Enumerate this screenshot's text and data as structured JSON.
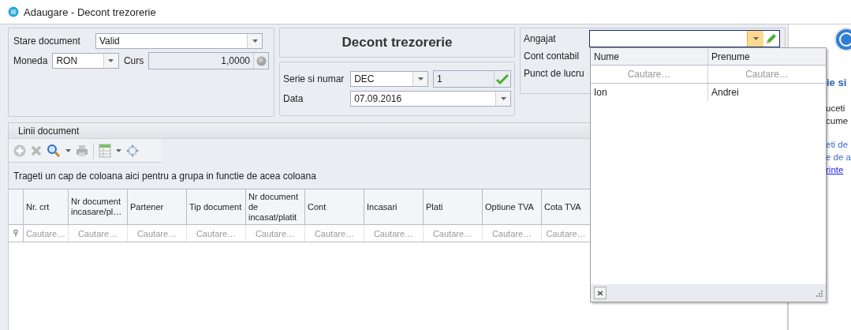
{
  "window": {
    "title": "Adaugare - Decont trezorerie"
  },
  "document": {
    "status_label": "Stare document",
    "status": "Valid",
    "currency_label": "Moneda",
    "currency": "RON",
    "rate_label": "Curs",
    "rate": "1,0000"
  },
  "header_title": "Decont trezorerie",
  "series": {
    "label": "Serie si numar",
    "series": "DEC",
    "number": "1",
    "date_label": "Data",
    "date": "07.09.2016"
  },
  "employee": {
    "label": "Angajat",
    "account_label": "Cont contabil",
    "workpoint_label": "Punct de lucru"
  },
  "lines": {
    "title": "Linii document",
    "toolbar": [
      {
        "kind": "add"
      },
      {
        "kind": "delete"
      },
      {
        "kind": "search"
      },
      {
        "kind": "print"
      },
      {
        "kind": "separator"
      },
      {
        "kind": "layout"
      },
      {
        "kind": "move"
      }
    ],
    "group_hint": "Trageti un cap de coloana aici pentru a grupa in functie de acea coloana",
    "columns": [
      {
        "header": "Nr. crt",
        "filter": "Cautare…"
      },
      {
        "header": "Nr document incasare/pl…",
        "filter": "Cautare…"
      },
      {
        "header": "Partener",
        "filter": "Cautare…"
      },
      {
        "header": "Tip document",
        "filter": "Cautare…"
      },
      {
        "header": "Nr document de incasat/platit",
        "filter": "Cautare…"
      },
      {
        "header": "Cont",
        "filter": "Cautare…"
      },
      {
        "header": "Incasari",
        "filter": "Cautare…"
      },
      {
        "header": "Plati",
        "filter": "Cautare…"
      },
      {
        "header": "Optiune TVA",
        "filter": "Cautare…"
      },
      {
        "header": "Cota TVA",
        "filter": "Cautare…"
      }
    ]
  },
  "dropdown": {
    "columns": [
      {
        "header": "Nume",
        "filter": "Cautare…"
      },
      {
        "header": "Prenume",
        "filter": "Cautare…"
      }
    ],
    "rows": [
      {
        "cells": [
          "Ion",
          "Andrei"
        ]
      }
    ]
  },
  "help": {
    "title": "ie si",
    "lines": [
      "uceti",
      "cume"
    ],
    "blue_lines": [
      "eti de",
      "e de a"
    ],
    "link": "rinte"
  }
}
